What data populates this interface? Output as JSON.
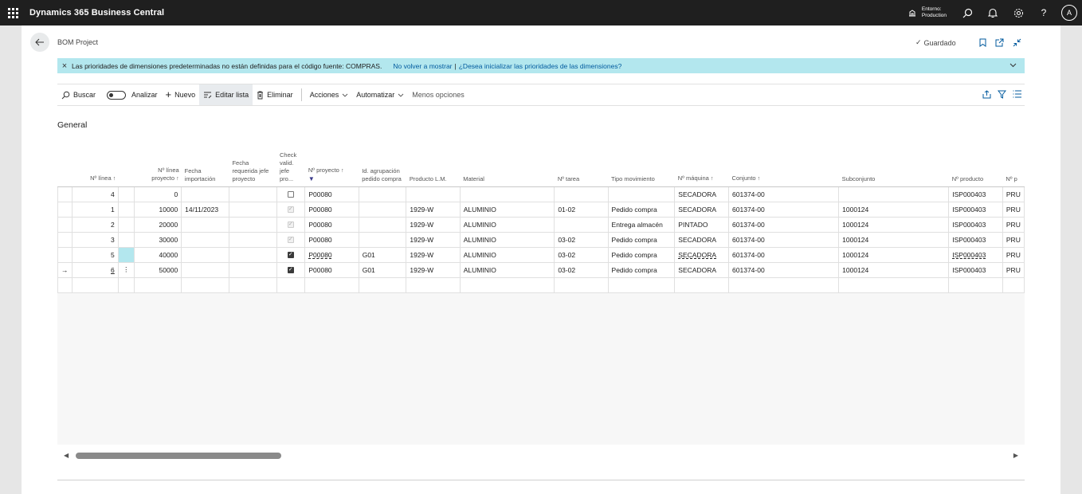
{
  "topbar": {
    "app_title": "Dynamics 365 Business Central",
    "env_line1": "Entorno:",
    "env_line2": "Production",
    "avatar_letter": "A",
    "icons": [
      "waffle-icon",
      "environment-icon",
      "search-icon",
      "bell-icon",
      "gear-icon",
      "help-icon"
    ]
  },
  "page": {
    "title": "BOM Project",
    "saved_label": "Guardado"
  },
  "notification": {
    "message": "Las prioridades de dimensiones predeterminadas no están definidas para el código fuente: COMPRAS.",
    "link1": "No volver a mostrar",
    "separator": "|",
    "link2": "¿Desea inicializar las prioridades de las dimensiones?"
  },
  "actions": {
    "search": "Buscar",
    "analyze": "Analizar",
    "new": "Nuevo",
    "edit_list": "Editar lista",
    "delete": "Eliminar",
    "actions": "Acciones",
    "automate": "Automatizar",
    "fewer_options": "Menos opciones"
  },
  "section": {
    "title": "General"
  },
  "grid": {
    "headers": {
      "line_no": "Nº línea",
      "project_line_no": "Nº línea proyecto",
      "import_date": "Fecha importación",
      "required_date": "Fecha requerida jefe proyecto",
      "check_valid": "Check valid. jefe pro...",
      "project_no": "Nº proyecto",
      "purchase_group": "Id. agrupación pedido compra",
      "product_lm": "Producto L.M.",
      "material": "Material",
      "task_no": "Nº tarea",
      "movement_type": "Tipo movimiento",
      "machine_no": "Nº máquina",
      "assembly": "Conjunto",
      "subassembly": "Subconjunto",
      "product_no": "Nº producto",
      "next_col": "Nº p"
    },
    "rows": [
      {
        "line_no": "4",
        "project_line_no": "0",
        "import_date": "",
        "check": "empty",
        "project_no": "P00080",
        "purchase_group": "",
        "product_lm": "",
        "material": "",
        "task_no": "",
        "movement_type": "",
        "machine_no": "SECADORA",
        "assembly": "601374-00",
        "subassembly": "",
        "product_no": "ISP000403",
        "next_col": "PRU"
      },
      {
        "line_no": "1",
        "project_line_no": "10000",
        "import_date": "14/11/2023",
        "check": "disabled",
        "project_no": "P00080",
        "purchase_group": "",
        "product_lm": "1929-W",
        "material": "ALUMINIO",
        "task_no": "01-02",
        "movement_type": "Pedido compra",
        "machine_no": "SECADORA",
        "assembly": "601374-00",
        "subassembly": "1000124",
        "product_no": "ISP000403",
        "next_col": "PRU"
      },
      {
        "line_no": "2",
        "project_line_no": "20000",
        "import_date": "",
        "check": "disabled",
        "project_no": "P00080",
        "purchase_group": "",
        "product_lm": "1929-W",
        "material": "ALUMINIO",
        "task_no": "",
        "movement_type": "Entrega almacén",
        "machine_no": "PINTADO",
        "assembly": "601374-00",
        "subassembly": "1000124",
        "product_no": "ISP000403",
        "next_col": "PRU"
      },
      {
        "line_no": "3",
        "project_line_no": "30000",
        "import_date": "",
        "check": "disabled",
        "project_no": "P00080",
        "purchase_group": "",
        "product_lm": "1929-W",
        "material": "ALUMINIO",
        "task_no": "03-02",
        "movement_type": "Pedido compra",
        "machine_no": "SECADORA",
        "assembly": "601374-00",
        "subassembly": "1000124",
        "product_no": "ISP000403",
        "next_col": "PRU"
      },
      {
        "line_no": "5",
        "project_line_no": "40000",
        "import_date": "",
        "check": "checked",
        "project_no": "P00080",
        "purchase_group": "G01",
        "product_lm": "1929-W",
        "material": "ALUMINIO",
        "task_no": "03-02",
        "movement_type": "Pedido compra",
        "machine_no": "SECADORA",
        "assembly": "601374-00",
        "subassembly": "1000124",
        "product_no": "ISP000403",
        "next_col": "PRU"
      },
      {
        "line_no": "6",
        "project_line_no": "50000",
        "import_date": "",
        "check": "checked",
        "project_no": "P00080",
        "purchase_group": "G01",
        "product_lm": "1929-W",
        "material": "ALUMINIO",
        "task_no": "03-02",
        "movement_type": "Pedido compra",
        "machine_no": "SECADORA",
        "assembly": "601374-00",
        "subassembly": "1000124",
        "product_no": "ISP000403",
        "next_col": "PRU"
      }
    ],
    "current_row_marker": "→",
    "row_menu_icon": "⋮"
  },
  "colors": {
    "topbar": "#1f1f1f",
    "notification": "#b3e7ee",
    "link": "#005a9e",
    "selected_cell": "#b3e7ee"
  }
}
